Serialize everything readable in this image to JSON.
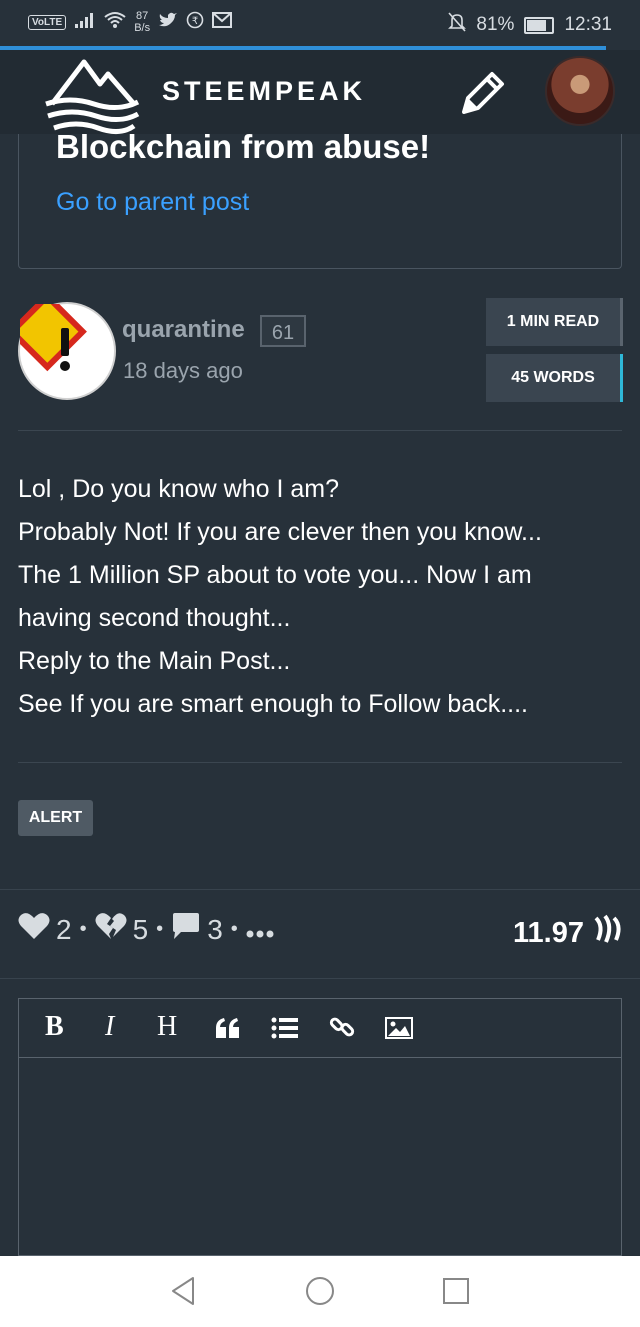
{
  "status_bar": {
    "network_badge": "VoLTE",
    "speed_value": "87",
    "speed_unit": "B/s",
    "battery_percent": "81%",
    "time": "12:31"
  },
  "header": {
    "brand": "STEEMPEAK"
  },
  "parent": {
    "title": "Blockchain from abuse!",
    "link_label": "Go to parent post"
  },
  "author": {
    "name": "quarantine",
    "reputation": "61",
    "time_ago": "18 days ago"
  },
  "stats": {
    "read_time": "1 MIN READ",
    "words": "45 WORDS"
  },
  "body_lines": [
    "Lol , Do you know who I am?",
    "Probably Not! If you are clever then you know...",
    "The 1 Million SP about to vote you... Now I am",
    "having second thought...",
    "Reply to the Main Post...",
    "See If you are smart enough to Follow back...."
  ],
  "tags": [
    "ALERT"
  ],
  "actions": {
    "upvotes": "2",
    "downvotes": "5",
    "comments": "3",
    "payout": "11.97"
  },
  "editor": {
    "bold": "B",
    "italic": "I",
    "heading": "H"
  },
  "colors": {
    "background": "#27313a",
    "header": "#222b33",
    "link": "#3aa0ff",
    "progress": "#2f8fd8"
  }
}
